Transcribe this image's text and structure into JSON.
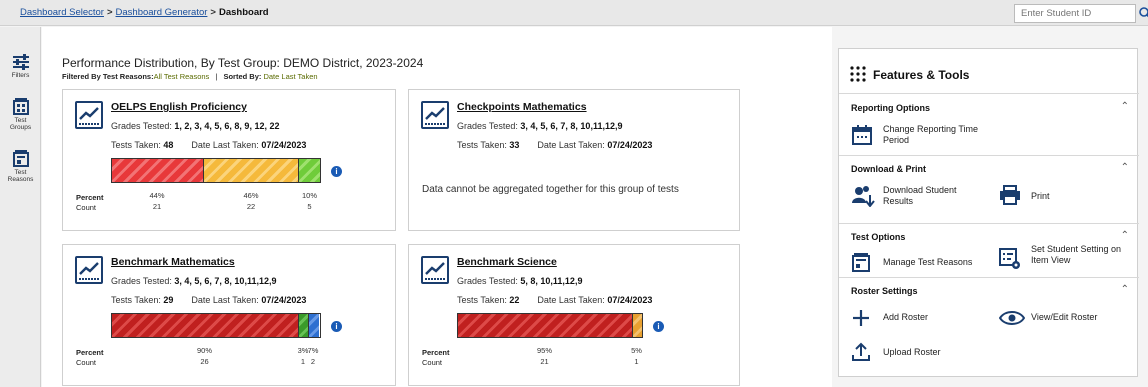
{
  "breadcrumbs": {
    "item1": "Dashboard Selector",
    "item2": "Dashboard Generator",
    "current": "Dashboard",
    "separator": ">"
  },
  "search": {
    "placeholder": "Enter Student ID"
  },
  "sidebar": {
    "items": [
      {
        "label": "Filters"
      },
      {
        "label": "Test Groups"
      },
      {
        "label": "Test Reasons"
      }
    ]
  },
  "header": {
    "title": "Performance Distribution, By Test Group: DEMO District, 2023-2024",
    "filtered_by_label": "Filtered By",
    "test_reasons_label": "Test Reasons:",
    "test_reasons_value": "All Test Reasons",
    "pipe": "|",
    "sorted_by_label": "Sorted By:",
    "sorted_by_value": "Date Last Taken"
  },
  "labels": {
    "grades_tested": "Grades Tested:",
    "tests_taken": "Tests Taken:",
    "date_last_taken": "Date Last Taken:",
    "percent": "Percent",
    "count": "Count"
  },
  "cards": [
    {
      "title": "OELPS English Proficiency",
      "grades": "1, 2, 3, 4, 5, 6, 8, 9, 12, 22",
      "tests_taken": "48",
      "date": "07/24/2023",
      "segments": [
        {
          "percent": "44%",
          "count": "21",
          "fraction": 0.44,
          "color": "#e8383a",
          "stripe": "#f27375"
        },
        {
          "percent": "46%",
          "count": "22",
          "fraction": 0.46,
          "color": "#f5b93b",
          "stripe": "#fbd47c"
        },
        {
          "percent": "10%",
          "count": "5",
          "fraction": 0.1,
          "color": "#6fcc3a",
          "stripe": "#9ee16e"
        }
      ]
    },
    {
      "title": "Checkpoints Mathematics",
      "grades": "3, 4, 5, 6, 7, 8, 10,11,12,9",
      "tests_taken": "33",
      "date": "07/24/2023",
      "message": "Data cannot be aggregated together for this group of tests"
    },
    {
      "title": "Benchmark Mathematics",
      "grades": "3, 4, 5, 6, 7, 8, 10,11,12,9",
      "tests_taken": "29",
      "date": "07/24/2023",
      "segments": [
        {
          "percent": "90%",
          "count": "26",
          "fraction": 0.9,
          "color": "#c0201f",
          "stripe": "#dd4a48"
        },
        {
          "percent": "3%",
          "count": "1",
          "fraction": 0.05,
          "color": "#3a9a2a",
          "stripe": "#68c255"
        },
        {
          "percent": "7%",
          "count": "2",
          "fraction": 0.05,
          "color": "#2e6fd0",
          "stripe": "#6799e6"
        }
      ]
    },
    {
      "title": "Benchmark Science",
      "grades": "5, 8, 10,11,12,9",
      "tests_taken": "22",
      "date": "07/24/2023",
      "segments": [
        {
          "percent": "95%",
          "count": "21",
          "fraction": 0.95,
          "color": "#c0201f",
          "stripe": "#dd4a48"
        },
        {
          "percent": "5%",
          "count": "1",
          "fraction": 0.05,
          "color": "#e8a030",
          "stripe": "#f3c06c"
        }
      ]
    }
  ],
  "info_icon": "i",
  "panel": {
    "title": "Features & Tools",
    "reporting_options": "Reporting Options",
    "change_period": "Change Reporting Time Period",
    "download_print": "Download & Print",
    "download_results": "Download Student Results",
    "print": "Print",
    "test_options": "Test Options",
    "manage_reasons": "Manage Test Reasons",
    "set_student_setting": "Set Student Setting on Item View",
    "roster_settings": "Roster Settings",
    "add_roster": "Add Roster",
    "view_edit_roster": "View/Edit Roster",
    "upload_roster": "Upload Roster"
  },
  "colors": {
    "navy": "#1a3d6e",
    "link": "#1a4f9c",
    "info": "#1a5bb5"
  }
}
